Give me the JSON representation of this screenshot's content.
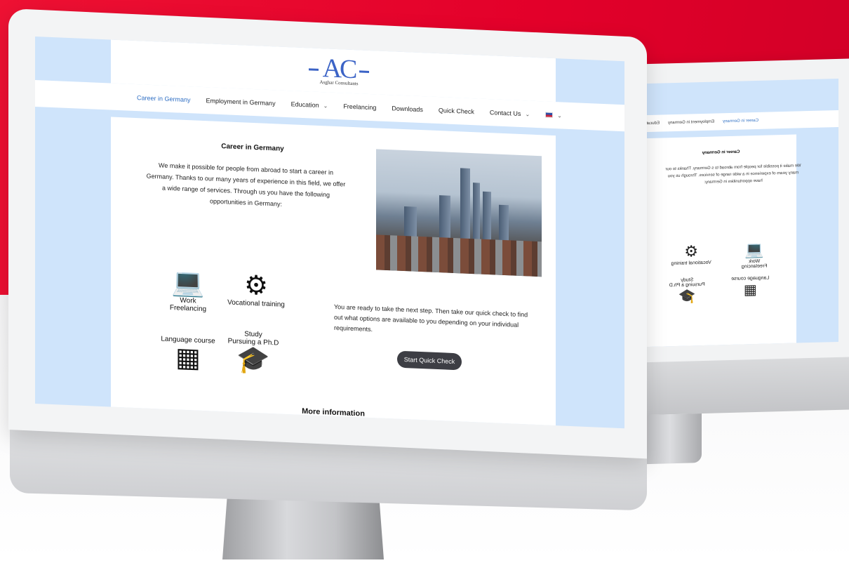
{
  "site": {
    "logo_text": "AC",
    "logo_subtitle": "Asghar Consultants"
  },
  "nav": {
    "items": [
      {
        "label": "Career in Germany",
        "active": true,
        "has_dropdown": false
      },
      {
        "label": "Employment in Germany",
        "active": false,
        "has_dropdown": false
      },
      {
        "label": "Education",
        "active": false,
        "has_dropdown": true
      },
      {
        "label": "Freelancing",
        "active": false,
        "has_dropdown": false
      },
      {
        "label": "Downloads",
        "active": false,
        "has_dropdown": false
      },
      {
        "label": "Quick Check",
        "active": false,
        "has_dropdown": false
      },
      {
        "label": "Contact Us",
        "active": false,
        "has_dropdown": true
      }
    ],
    "language_icon": "uk-flag-icon"
  },
  "main": {
    "title": "Career in Germany",
    "intro": "We make it possible for people from abroad to start a career in Germany. Thanks to our many years of experience in this field, we offer a wide range of services. Through us you have the following opportunities in Germany:",
    "services": [
      {
        "label": "Work\nFreelancing",
        "icon": "laptop-job-icon"
      },
      {
        "label": "Vocational training",
        "icon": "team-gear-icon"
      },
      {
        "label": "Language course",
        "icon": "teacher-board-icon"
      },
      {
        "label": "Study\nPursuing a Ph.D",
        "icon": "graduate-icon"
      }
    ],
    "cta_text": "You are ready to take the next step. Then take our quick check to find out what options are available to you depending on your individual requirements.",
    "cta_button": "Start Quick Check",
    "more_info": "More information"
  },
  "back_screen": {
    "nav_items": [
      "Career in Germany",
      "Employment in Germany",
      "Educati"
    ],
    "title": "Career in Germany",
    "intro": "We make it possible for people from abroad to s Germany. Thanks to our many years of experience in a wide range of services. Through us you have opportunities in Germany:",
    "service_labels": [
      "Work",
      "Freelancing",
      "Vocational training",
      "Language course",
      "Study",
      "Pursuing a Ph.D"
    ]
  },
  "colors": {
    "background_red": "#e3002a",
    "screen_blue": "#cfe4fb",
    "nav_active": "#2f6fc4",
    "button_bg": "#3d3e44"
  }
}
